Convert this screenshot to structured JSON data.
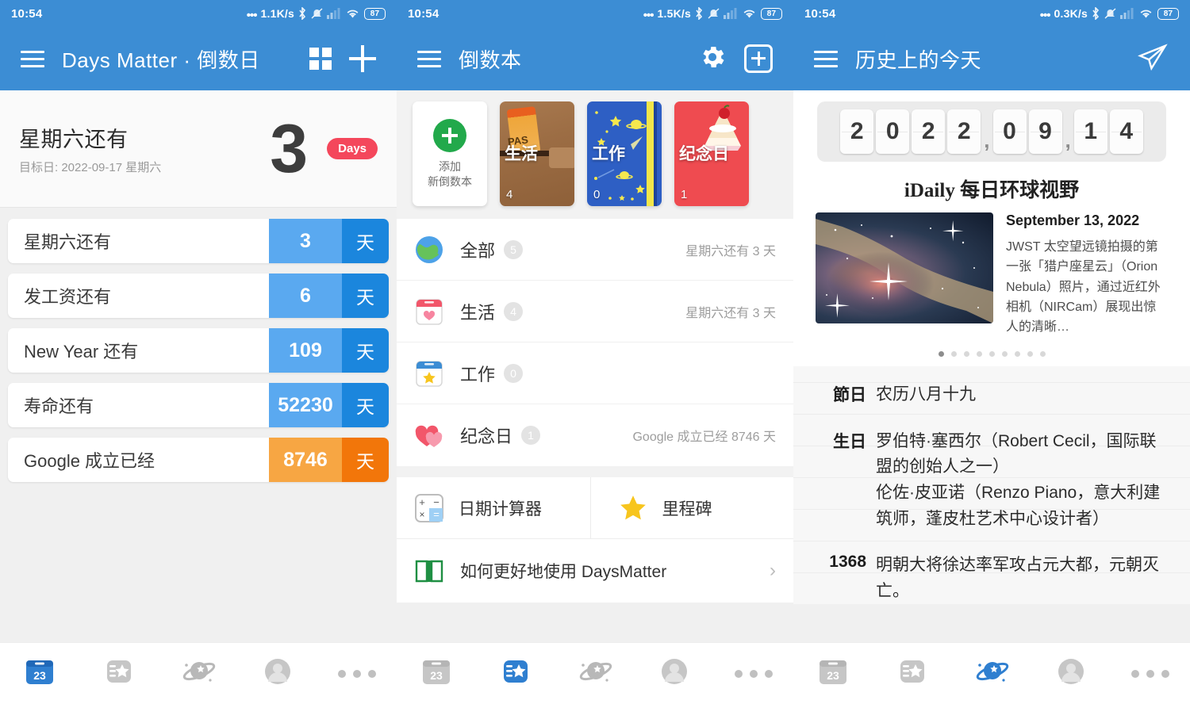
{
  "panels": [
    {
      "status": {
        "time": "10:54",
        "speed": "1.1K/s",
        "battery": "87"
      },
      "appbar": {
        "title": "Days Matter · 倒数日"
      },
      "hero": {
        "title": "星期六还有",
        "subtitle": "目标日: 2022-09-17 星期六",
        "number": "3",
        "badge": "Days"
      },
      "countdowns": [
        {
          "label": "星期六还有",
          "value": "3",
          "unit": "天",
          "color": "#5aa9f0",
          "dark": "#1b86dd"
        },
        {
          "label": "发工资还有",
          "value": "6",
          "unit": "天",
          "color": "#5aa9f0",
          "dark": "#1b86dd"
        },
        {
          "label": "New Year 还有",
          "value": "109",
          "unit": "天",
          "color": "#5aa9f0",
          "dark": "#1b86dd"
        },
        {
          "label": "寿命还有",
          "value": "52230",
          "unit": "天",
          "color": "#5aa9f0",
          "dark": "#1b86dd"
        },
        {
          "label": "Google 成立已经",
          "value": "8746",
          "unit": "天",
          "color": "#f7a643",
          "dark": "#f2760a"
        }
      ]
    },
    {
      "status": {
        "time": "10:54",
        "speed": "1.5K/s",
        "battery": "87"
      },
      "appbar": {
        "title": "倒数本"
      },
      "add_book": {
        "line1": "添加",
        "line2": "新倒数本"
      },
      "books": [
        {
          "name": "生活",
          "count": "4"
        },
        {
          "name": "工作",
          "count": "0"
        },
        {
          "name": "纪念日",
          "count": "1"
        }
      ],
      "categories": [
        {
          "icon": "globe-icon",
          "name": "全部",
          "count": "5",
          "right": "星期六还有 3 天"
        },
        {
          "icon": "calendar-heart-icon",
          "name": "生活",
          "count": "4",
          "right": "星期六还有 3 天"
        },
        {
          "icon": "calendar-star-icon",
          "name": "工作",
          "count": "0",
          "right": ""
        },
        {
          "icon": "hearts-icon",
          "name": "纪念日",
          "count": "1",
          "right": "Google 成立已经 8746 天"
        }
      ],
      "tools": [
        {
          "icon": "calculator-icon",
          "name": "日期计算器"
        },
        {
          "icon": "star-icon",
          "name": "里程碑"
        }
      ],
      "help": {
        "icon": "book-icon",
        "name": "如何更好地使用 DaysMatter",
        "chevron": "›"
      }
    },
    {
      "status": {
        "time": "10:54",
        "speed": "0.3K/s",
        "battery": "87"
      },
      "appbar": {
        "title": "历史上的今天"
      },
      "flipdate": {
        "digits": [
          "2",
          "0",
          "2",
          "2",
          "0",
          "9",
          "1",
          "4"
        ],
        "sep": ","
      },
      "idaily": {
        "brand": "iDaily 每日环球视野",
        "date": "September 13, 2022",
        "desc": "JWST 太空望远镜拍摄的第一张「猎户座星云」（Orion Nebula）照片，通过近红外相机（NIRCam）展现出惊人的清晰…",
        "dots_total": 9,
        "dots_active": 0
      },
      "history": [
        {
          "key": "節日",
          "value": "农历八月十九"
        },
        {
          "key": "生日",
          "value": "罗伯特·塞西尔（Robert Cecil，国际联盟的创始人之一）\n伦佐·皮亚诺（Renzo Piano，意大利建筑师，蓬皮杜艺术中心设计者）"
        },
        {
          "key": "1368",
          "value": "明朝大将徐达率军攻占元大都，元朝灭亡。"
        }
      ]
    }
  ],
  "bottomnav": [
    {
      "icon": "calendar-23-icon",
      "active_panel": 0
    },
    {
      "icon": "notebook-star-icon",
      "active_panel": 1
    },
    {
      "icon": "planet-icon",
      "active_panel": 2
    },
    {
      "icon": "avatar-icon",
      "active_panel": -1
    },
    {
      "icon": "more-dots-icon",
      "active_panel": -1
    }
  ],
  "colors": {
    "appbar": "#3c8dd4",
    "accent_blue": "#1b86dd",
    "accent_orange": "#f2760a",
    "badge_red": "#f4475b"
  }
}
